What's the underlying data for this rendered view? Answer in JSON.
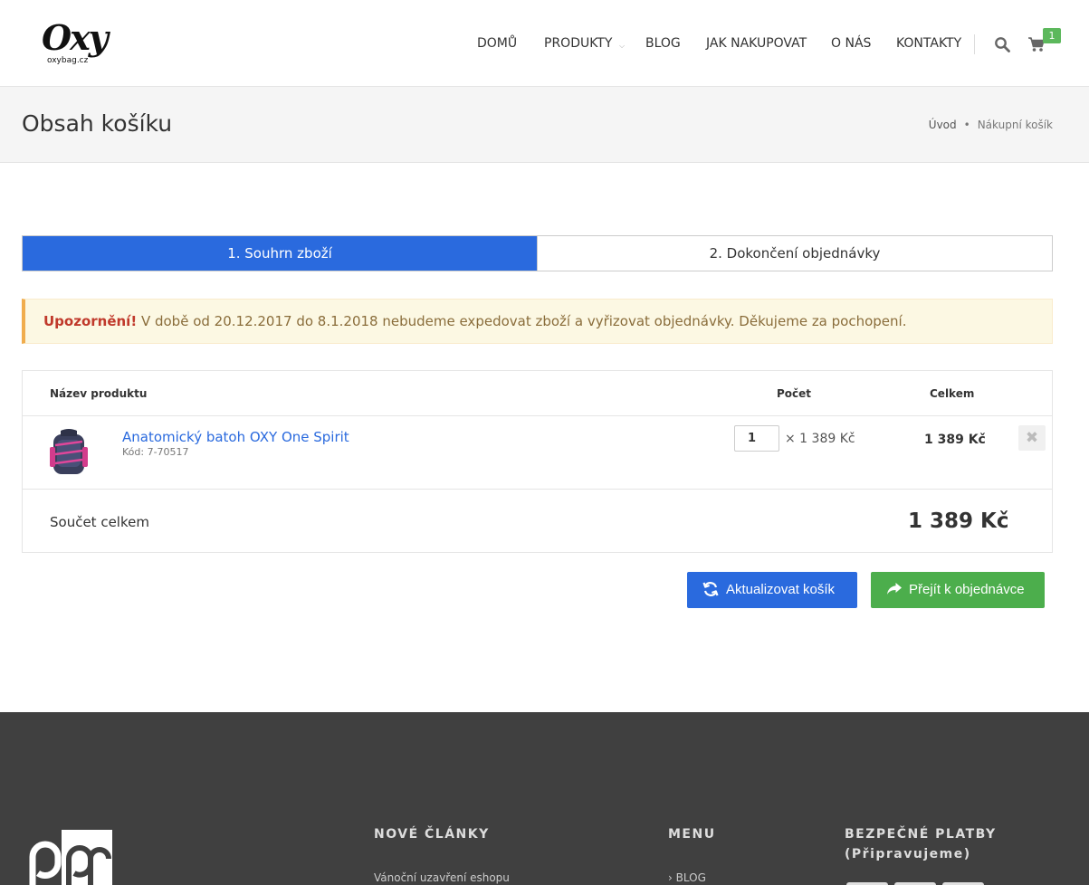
{
  "header": {
    "logo_text": "Oxy",
    "logo_sub": "oxybag.cz",
    "nav": [
      {
        "label": "DOMŮ"
      },
      {
        "label": "PRODUKTY"
      },
      {
        "label": "BLOG"
      },
      {
        "label": "JAK NAKUPOVAT"
      },
      {
        "label": "O NÁS"
      },
      {
        "label": "KONTAKTY"
      }
    ],
    "cart_count": "1"
  },
  "titlebar": {
    "title": "Obsah košíku",
    "breadcrumb": [
      "Úvod",
      "Nákupní košík"
    ],
    "breadcrumb_sep": "•"
  },
  "steps": [
    {
      "label": "1. Souhrn zboží",
      "active": true
    },
    {
      "label": "2. Dokončení objednávky",
      "active": false
    }
  ],
  "alert": {
    "strong": "Upozornění!",
    "text": "V době od 20.12.2017 do 8.1.2018 nebudeme expedovat zboží a vyřizovat objednávky. Děkujeme za pochopení."
  },
  "cart": {
    "columns": {
      "name": "Název produktu",
      "qty": "Počet",
      "total": "Celkem"
    },
    "items": [
      {
        "name": "Anatomický batoh OXY One Spirit",
        "code": "Kód: 7-70517",
        "qty": "1",
        "unit_price": "× 1 389 Kč",
        "total": "1 389 Kč",
        "remove_icon": "✖"
      }
    ],
    "sum_label": "Součet celkem",
    "sum_value": "1 389 Kč"
  },
  "buttons": {
    "update": "Aktualizovat košík",
    "order": "Přejít k objednávce"
  },
  "footer": {
    "columns": [
      {
        "heading": "NOVÉ ČLÁNKY",
        "link": "Vánoční uzavření eshopu"
      },
      {
        "heading": "MENU",
        "link": "BLOG"
      },
      {
        "heading": "BEZPEČNÉ PLATBY (Připravujeme)"
      }
    ],
    "menu_link_prefix": "›"
  },
  "colors": {
    "primary": "#2a6ade",
    "success": "#4cae4c",
    "badge": "#5cb85c",
    "footer_bg": "#404040",
    "alert_bg": "#fcf8e3"
  },
  "icons": {
    "search": "search-icon",
    "cart": "cart-icon",
    "update": "refresh-icon",
    "order": "share-arrow-icon",
    "remove": "close-icon"
  }
}
